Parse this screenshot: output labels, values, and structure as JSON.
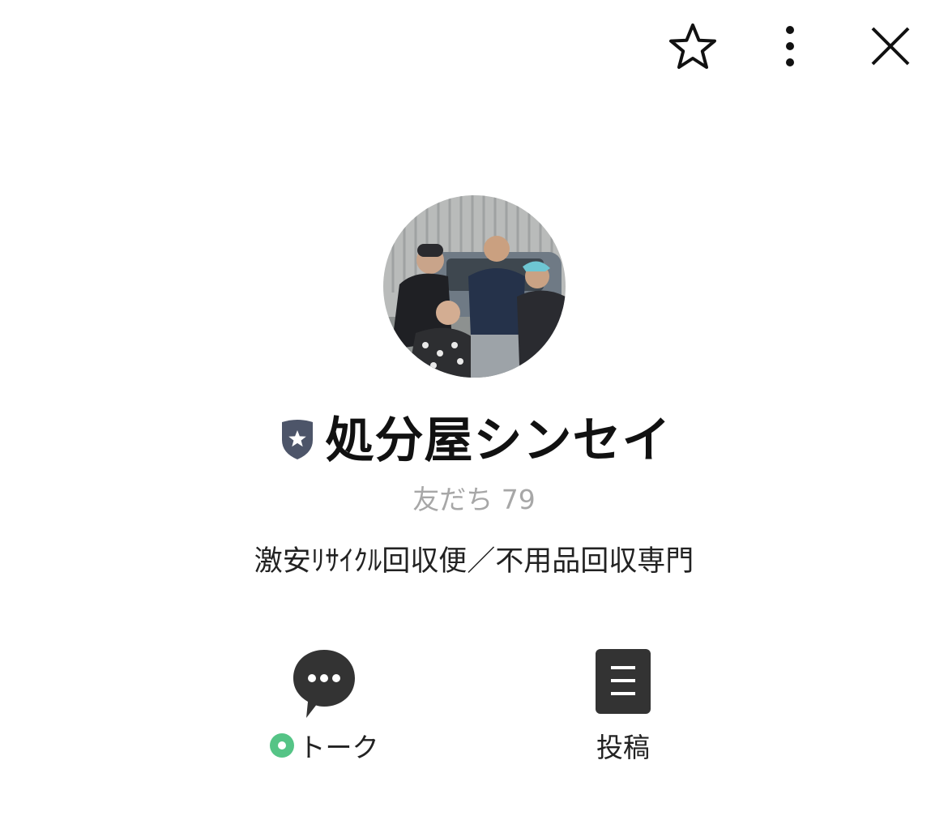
{
  "header": {
    "favorite_icon": "star-outline-icon",
    "more_icon": "vertical-ellipsis-icon",
    "close_icon": "close-x-icon"
  },
  "profile": {
    "avatar_alt": "",
    "badge_icon": "shield-star-badge-icon",
    "badge_color": "#4d5569",
    "name": "処分屋シンセイ",
    "friends_label": "友だち",
    "friends_count": "79",
    "status_message": "激安ﾘｻｲｸﾙ回収便／不用品回収専門"
  },
  "actions": {
    "talk": {
      "icon": "speech-bubble-icon",
      "label": "トーク",
      "indicator_color": "#55c486"
    },
    "posts": {
      "icon": "document-list-icon",
      "label": "投稿"
    }
  },
  "colors": {
    "background": "#ffffff",
    "text": "#111111",
    "muted_text": "#a7a7a7",
    "icon_dark": "#333333"
  }
}
